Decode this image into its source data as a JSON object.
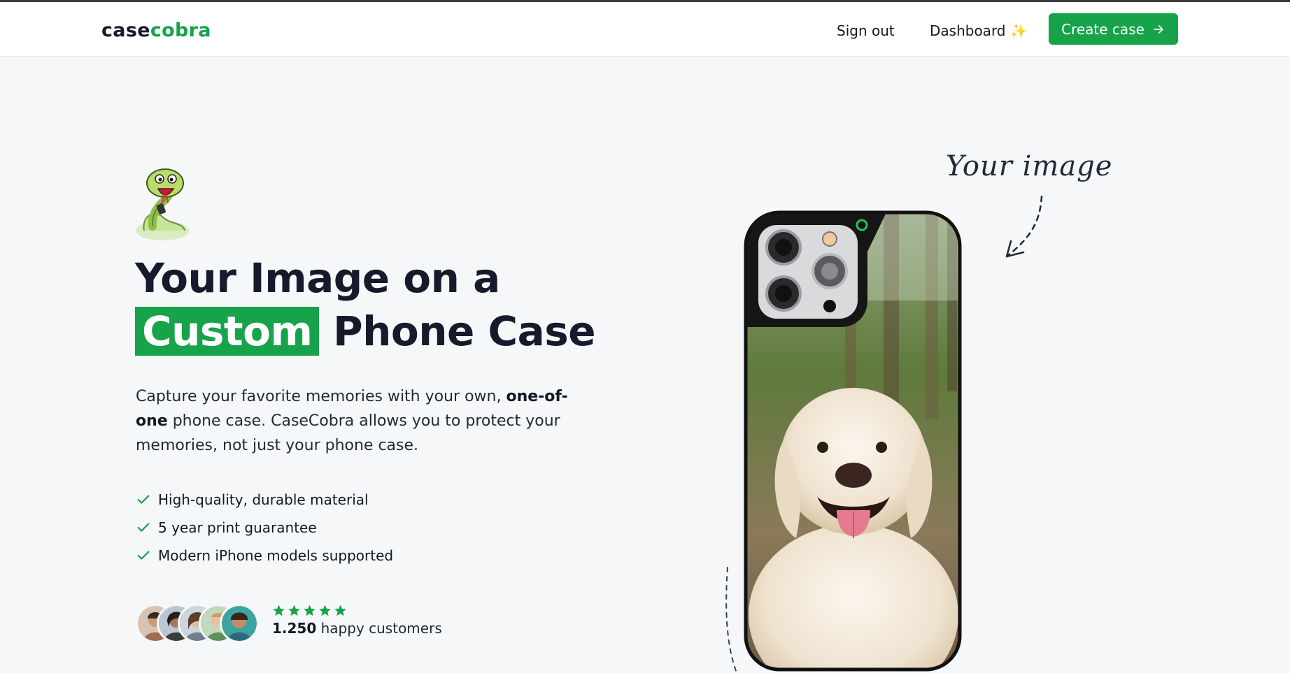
{
  "nav": {
    "logo_part1": "case",
    "logo_part2": "cobra",
    "signout_label": "Sign out",
    "dashboard_label": "Dashboard",
    "dashboard_emoji": "✨",
    "cta_label": "Create case"
  },
  "hero": {
    "headline_line1": "Your Image on a",
    "headline_highlight": "Custom",
    "headline_line2_rest": "Phone Case",
    "sub_part1": "Capture your favorite memories with your own, ",
    "sub_bold": "one-of-one",
    "sub_part2": " phone case. CaseCobra allows you to protect your memories, not just your phone case.",
    "features": [
      "High-quality, durable material",
      "5 year print guarantee",
      "Modern iPhone models supported"
    ],
    "rating_stars": 5,
    "customers_count": "1.250",
    "customers_suffix": " happy customers"
  },
  "annotation": {
    "your_image_label": "Your image"
  },
  "colors": {
    "brand_green": "#16a34a",
    "text_dark": "#161b2c",
    "background": "#f6f7f8"
  },
  "icons": [
    "snake-mascot-icon",
    "arrow-right-icon",
    "check-icon",
    "star-icon",
    "dashed-arrow-icon"
  ]
}
